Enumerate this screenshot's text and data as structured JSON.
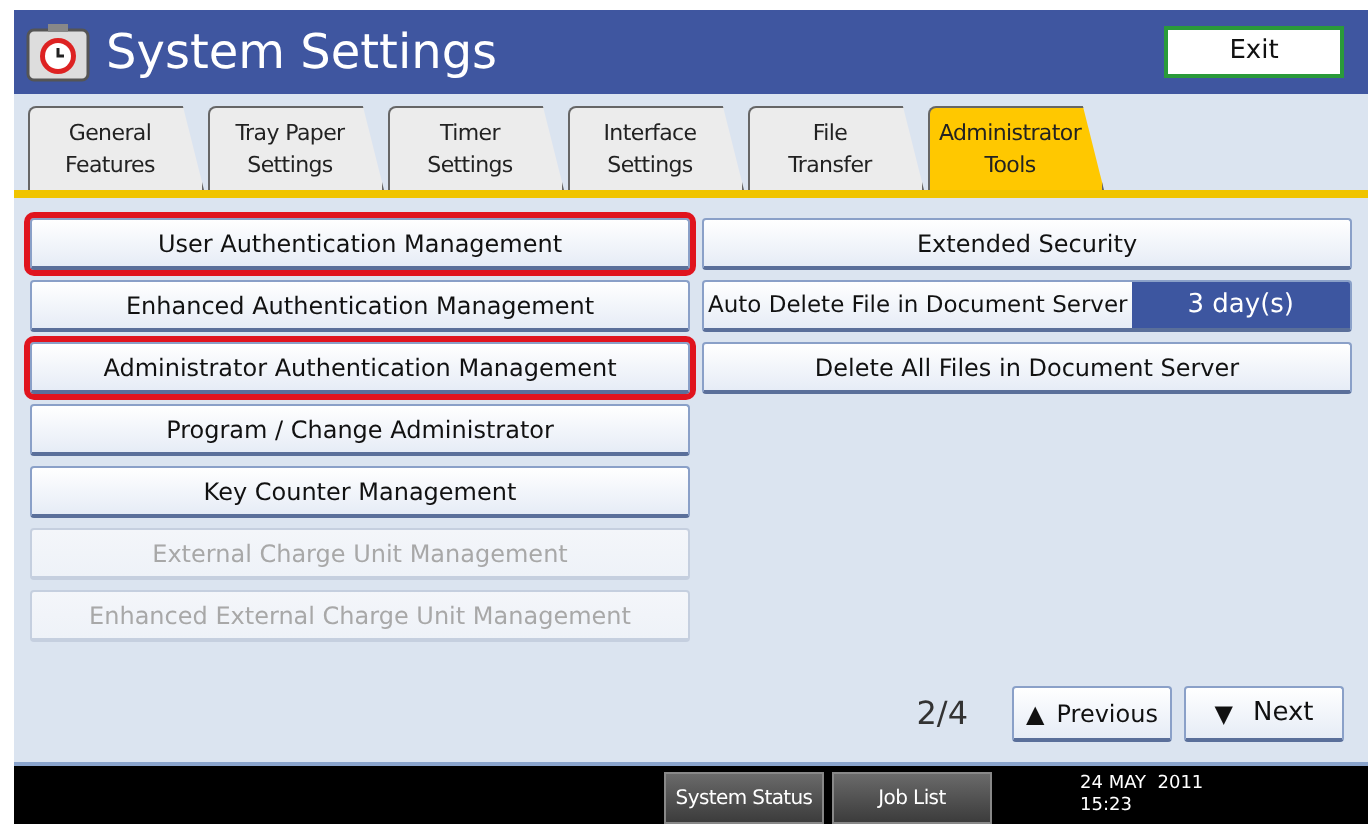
{
  "header": {
    "title": "System Settings",
    "exit": "Exit"
  },
  "tabs": [
    {
      "label": "General\nFeatures",
      "selected": false
    },
    {
      "label": "Tray Paper\nSettings",
      "selected": false
    },
    {
      "label": "Timer\nSettings",
      "selected": false
    },
    {
      "label": "Interface\nSettings",
      "selected": false
    },
    {
      "label": "File\nTransfer",
      "selected": false
    },
    {
      "label": "Administrator\nTools",
      "selected": true
    }
  ],
  "left_buttons": [
    {
      "label": "User Authentication Management",
      "highlighted": true,
      "disabled": false
    },
    {
      "label": "Enhanced Authentication Management",
      "highlighted": false,
      "disabled": false
    },
    {
      "label": "Administrator Authentication Management",
      "highlighted": true,
      "disabled": false
    },
    {
      "label": "Program / Change Administrator",
      "highlighted": false,
      "disabled": false
    },
    {
      "label": "Key Counter Management",
      "highlighted": false,
      "disabled": false
    },
    {
      "label": "External Charge Unit Management",
      "highlighted": false,
      "disabled": true
    },
    {
      "label": "Enhanced External Charge Unit Management",
      "highlighted": false,
      "disabled": true
    }
  ],
  "right_buttons": [
    {
      "kind": "button",
      "label": "Extended Security"
    },
    {
      "kind": "setting",
      "label": "Auto Delete File in Document Server",
      "value": "3 day(s)"
    },
    {
      "kind": "button",
      "label": "Delete All Files in Document Server"
    }
  ],
  "pager": {
    "page": "2/4",
    "previous": "Previous",
    "next": "Next",
    "previous_glyph": "▲",
    "next_glyph": "▼"
  },
  "status_bar": {
    "buttons": [
      "System Status",
      "Job List"
    ],
    "date": "24 MAY  2011",
    "time": "15:23"
  }
}
